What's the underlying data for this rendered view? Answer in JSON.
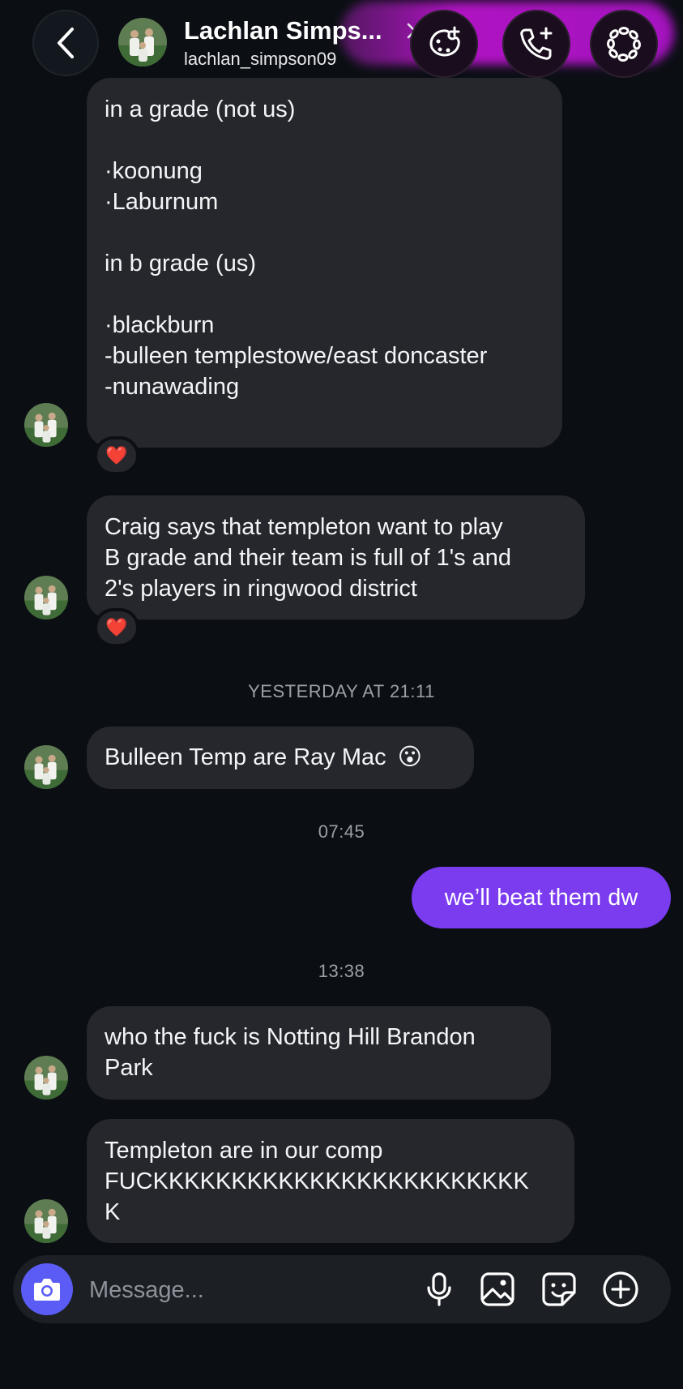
{
  "header": {
    "name": "Lachlan Simps...",
    "username": "lachlan_simpson09",
    "icons": [
      "back-icon",
      "chevron-right-icon",
      "effects-icon",
      "add-call-icon",
      "more-icon"
    ]
  },
  "messages": {
    "m1": {
      "lines": [
        "in a grade (not us)",
        "",
        "·koonung",
        "·Laburnum",
        "",
        "in b grade (us)",
        "",
        "·blackburn",
        "-bulleen templestowe/east doncaster",
        "-nunawading"
      ],
      "reaction": "❤️"
    },
    "m2": {
      "lines": [
        "Craig says that templeton want to play",
        "B grade and their team is full of 1's and",
        "2's players in ringwood district"
      ],
      "reaction": "❤️"
    },
    "ts1": "YESTERDAY AT 21:11",
    "m3": {
      "text": "Bulleen Temp are Ray Mac",
      "emoji": "😮"
    },
    "ts2": "07:45",
    "sent1": "we’ll beat them dw",
    "ts3": "13:38",
    "m4": {
      "lines": [
        "who the fuck is Notting Hill Brandon",
        "Park"
      ]
    },
    "m5": {
      "lines": [
        "Templeton are in our comp",
        "FUCKKKKKKKKKKKKKKKKKKKKKKKK",
        "K"
      ]
    }
  },
  "composer": {
    "placeholder": "Message...",
    "icons": [
      "camera-icon",
      "microphone-icon",
      "gallery-icon",
      "sticker-icon",
      "plus-icon"
    ]
  },
  "colors": {
    "background": "#0b0f14",
    "received_bubble": "#25272c",
    "sent_bubble": "#7b3cf0",
    "camera_button": "#5b5cf6",
    "header_glow": "#d21de8"
  }
}
